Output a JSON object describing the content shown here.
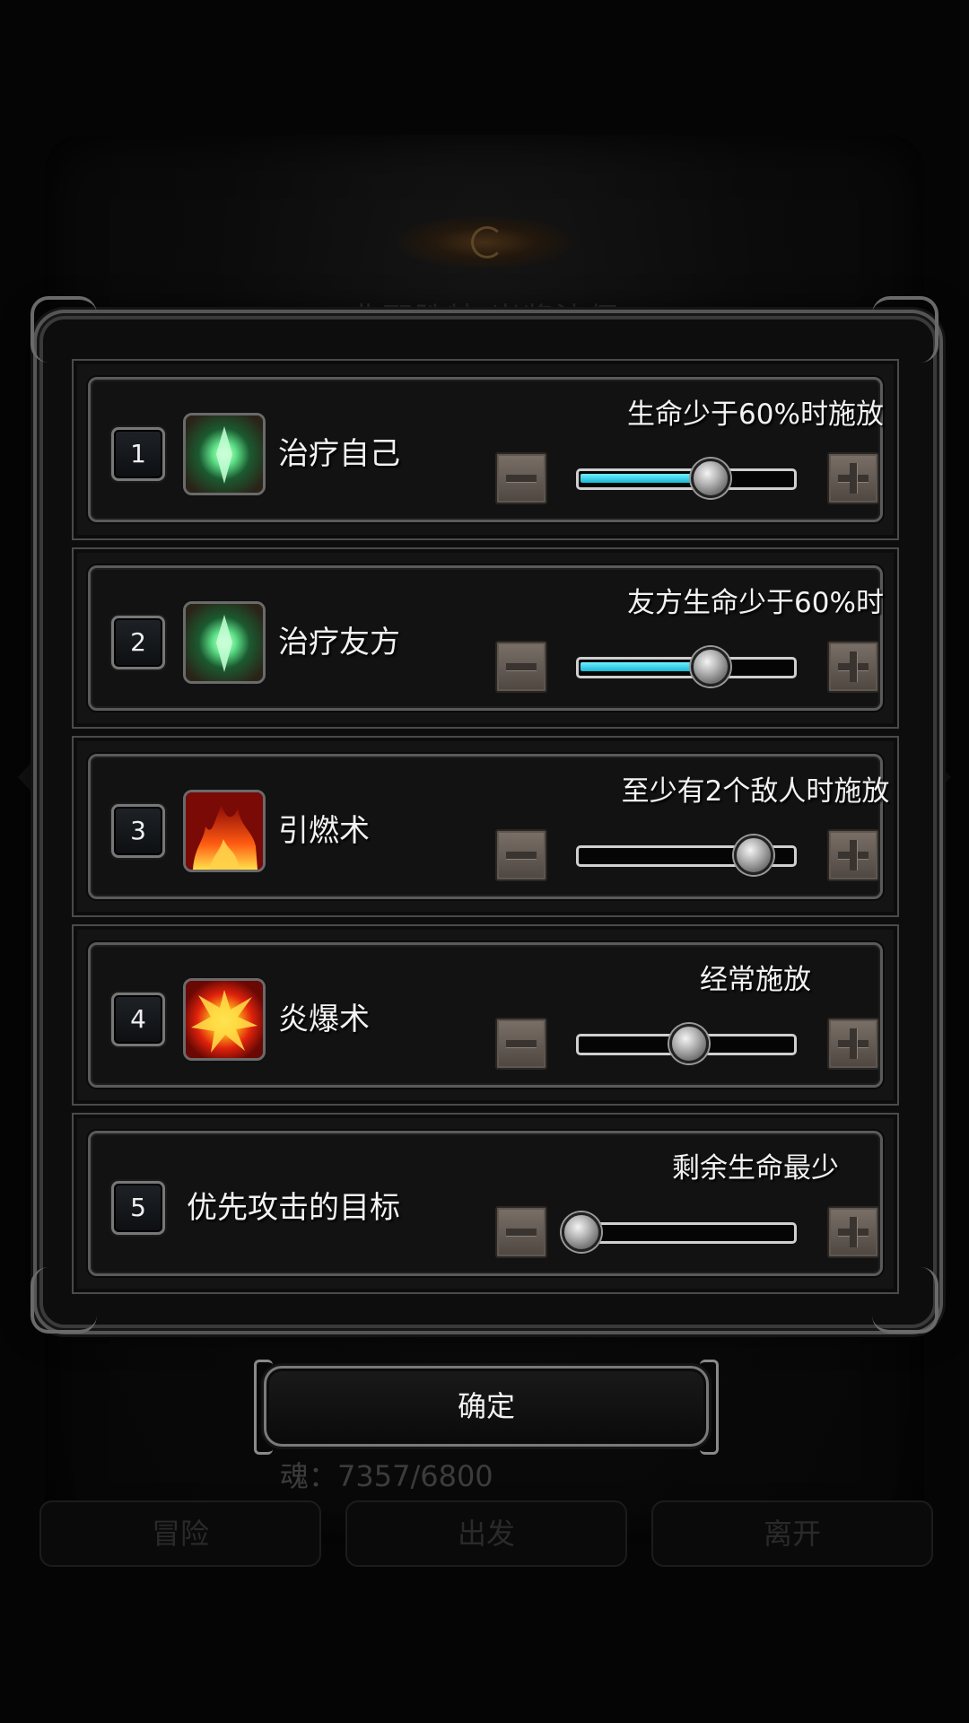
{
  "background": {
    "title": "弗邪胜特·岩浆法师",
    "soul_text": "魂：7357/6800",
    "buttons": [
      "冒险",
      "出发",
      "离开"
    ]
  },
  "skills": [
    {
      "number": "1",
      "name": "治疗自己",
      "icon": "heal-crystal-icon",
      "condition": "生命少于60%时施放",
      "slider_value": 0.6,
      "slider_filled": true
    },
    {
      "number": "2",
      "name": "治疗友方",
      "icon": "heal-crystal-icon",
      "condition": "友方生命少于60%时",
      "slider_value": 0.6,
      "slider_filled": true
    },
    {
      "number": "3",
      "name": "引燃术",
      "icon": "fire-icon",
      "condition": "至少有2个敌人时施放",
      "slider_value": 0.8,
      "slider_filled": false
    },
    {
      "number": "4",
      "name": "炎爆术",
      "icon": "explosion-icon",
      "condition": "经常施放",
      "slider_value": 0.5,
      "slider_filled": false
    },
    {
      "number": "5",
      "name": "优先攻击的目标",
      "icon": "",
      "condition": "剩余生命最少",
      "slider_value": 0.0,
      "slider_filled": false
    }
  ],
  "confirm_label": "确定",
  "colors": {
    "slider_fill": "#19b7d4",
    "frame": "#5a5a5a"
  }
}
